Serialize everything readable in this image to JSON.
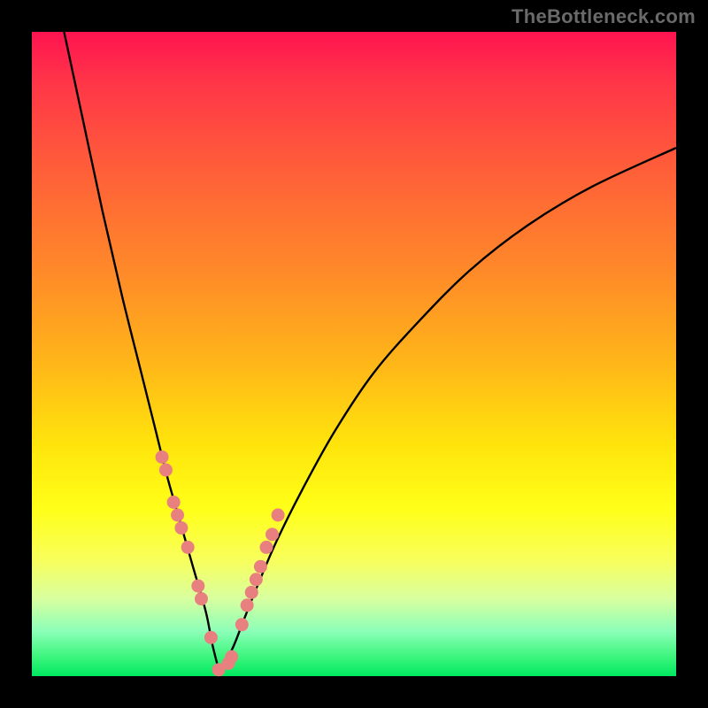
{
  "watermark": "TheBottleneck.com",
  "colors": {
    "curve": "#000000",
    "dot": "#e98080",
    "gradient_top": "#ff1450",
    "gradient_bottom": "#00e860"
  },
  "chart_data": {
    "type": "line",
    "title": "",
    "xlabel": "",
    "ylabel": "",
    "xlim": [
      0,
      100
    ],
    "ylim": [
      0,
      100
    ],
    "x_optimum": 29,
    "series": [
      {
        "name": "left-branch",
        "x": [
          5,
          8,
          11,
          14,
          17,
          19,
          21,
          23,
          25,
          27,
          28,
          29
        ],
        "y": [
          100,
          86,
          72,
          59,
          47,
          39,
          31,
          24,
          17,
          10,
          5,
          1
        ]
      },
      {
        "name": "right-branch",
        "x": [
          29,
          31,
          33,
          35,
          38,
          42,
          47,
          53,
          60,
          68,
          77,
          87,
          100
        ],
        "y": [
          1,
          4,
          9,
          14,
          21,
          29,
          38,
          47,
          55,
          63,
          70,
          76,
          82
        ]
      }
    ],
    "dots": {
      "name": "markers",
      "x": [
        20.2,
        20.8,
        22.0,
        22.6,
        23.2,
        24.2,
        25.8,
        26.3,
        27.8,
        29.0,
        30.5,
        31.0,
        32.6,
        33.4,
        34.1,
        34.8,
        35.5,
        36.4,
        37.3,
        38.2
      ],
      "y": [
        34,
        32,
        27,
        25,
        23,
        20,
        14,
        12,
        6,
        1,
        2,
        3,
        8,
        11,
        13,
        15,
        17,
        20,
        22,
        25
      ]
    }
  }
}
